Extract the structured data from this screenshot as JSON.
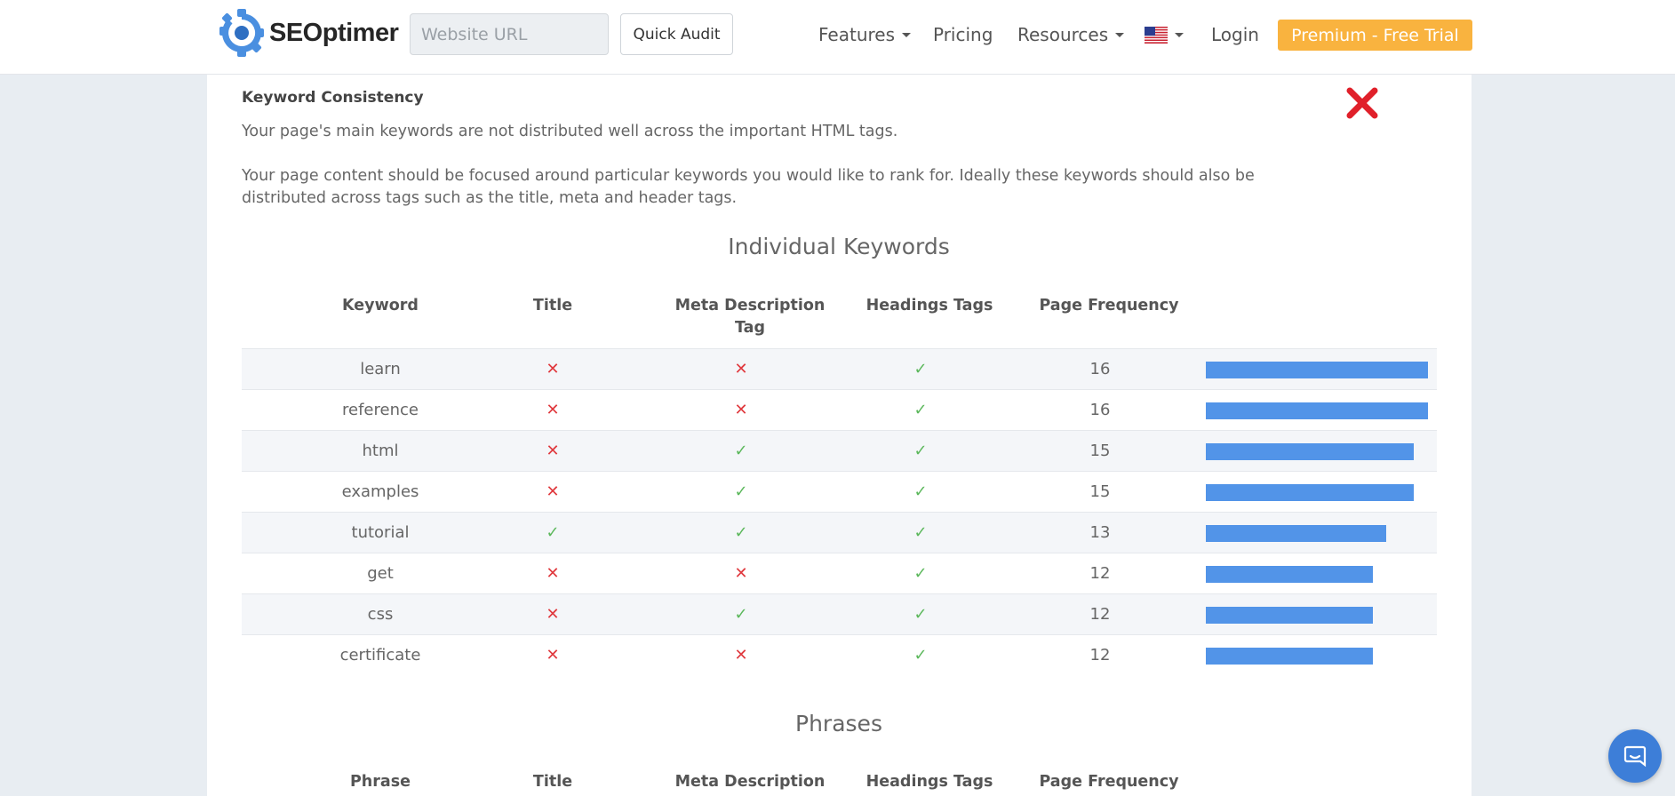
{
  "navbar": {
    "logo_text": "SEOptimer",
    "url_placeholder": "Website URL",
    "quick_audit_label": "Quick Audit",
    "features_label": "Features",
    "pricing_label": "Pricing",
    "resources_label": "Resources",
    "login_label": "Login",
    "premium_label": "Premium - Free Trial",
    "premium_color": "#f9b33f"
  },
  "section": {
    "title": "Keyword Consistency",
    "status": "fail",
    "summary": "Your page's main keywords are not distributed well across the important HTML tags.",
    "description": "Your page content should be focused around particular keywords you would like to rank for. Ideally these keywords should also be distributed across tags such as the title, meta and header tags."
  },
  "individual_keywords": {
    "heading": "Individual Keywords",
    "columns": [
      "Keyword",
      "Title",
      "Meta Description Tag",
      "Headings Tags",
      "Page Frequency"
    ],
    "max_frequency": 16,
    "rows": [
      {
        "keyword": "learn",
        "title": false,
        "meta": false,
        "headings": true,
        "frequency": "16"
      },
      {
        "keyword": "reference",
        "title": false,
        "meta": false,
        "headings": true,
        "frequency": "16"
      },
      {
        "keyword": "html",
        "title": false,
        "meta": true,
        "headings": true,
        "frequency": "15"
      },
      {
        "keyword": "examples",
        "title": false,
        "meta": true,
        "headings": true,
        "frequency": "15"
      },
      {
        "keyword": "tutorial",
        "title": true,
        "meta": true,
        "headings": true,
        "frequency": "13"
      },
      {
        "keyword": "get",
        "title": false,
        "meta": false,
        "headings": true,
        "frequency": "12"
      },
      {
        "keyword": "css",
        "title": false,
        "meta": true,
        "headings": true,
        "frequency": "12"
      },
      {
        "keyword": "certificate",
        "title": false,
        "meta": false,
        "headings": true,
        "frequency": "12"
      }
    ]
  },
  "phrases": {
    "heading": "Phrases",
    "columns": [
      "Phrase",
      "Title",
      "Meta Description",
      "Headings Tags",
      "Page Frequency"
    ]
  },
  "colors": {
    "bar": "#5294e8",
    "check": "#5cb85c",
    "cross": "#e0393e",
    "status_fail": "#e0202a"
  },
  "icons": {
    "logo": "gear-logo-icon",
    "flag": "us-flag-icon",
    "status": "cross-icon",
    "chat": "chat-icon"
  }
}
